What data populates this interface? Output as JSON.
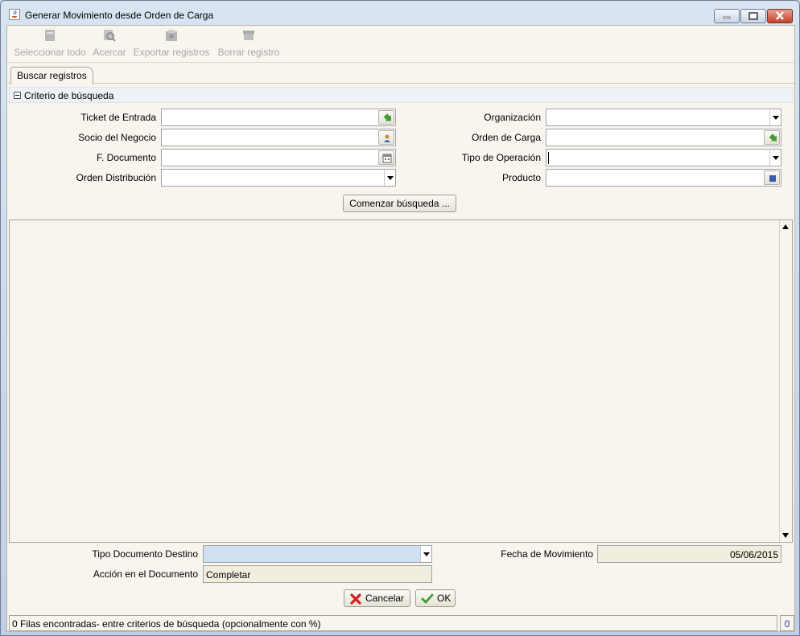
{
  "window": {
    "title": "Generar Movimiento desde Orden de Carga"
  },
  "toolbar": {
    "select_all": "Seleccionar todo",
    "zoom": "Acercar",
    "export": "Exportar registros",
    "delete": "Borrar registro"
  },
  "tabs": [
    {
      "label": "Buscar registros"
    }
  ],
  "criteria": {
    "title": "Criterio de búsqueda",
    "ticket_label": "Ticket de Entrada",
    "partner_label": "Socio del Negocio",
    "doc_date_label": "F. Documento",
    "distribution_label": "Orden Distribución",
    "organization_label": "Organización",
    "load_order_label": "Orden de Carga",
    "operation_type_label": "Tipo de Operación",
    "product_label": "Producto",
    "search_button": "Comenzar búsqueda ..."
  },
  "bottom": {
    "target_doctype_label": "Tipo Documento Destino",
    "doc_action_label": "Acción en el Documento",
    "doc_action_value": "Completar",
    "movement_date_label": "Fecha de Movimiento",
    "movement_date_value": "05/06/2015",
    "cancel_label": "Cancelar",
    "ok_label": "OK"
  },
  "status": {
    "message": "0 Filas encontradas- entre criterios de búsqueda (opcionalmente con %)",
    "count": "0"
  },
  "colors": {
    "accent_selected_field": "#cfe0f3",
    "readonly_field": "#f0eedf",
    "count_text": "#1c3aa8"
  }
}
